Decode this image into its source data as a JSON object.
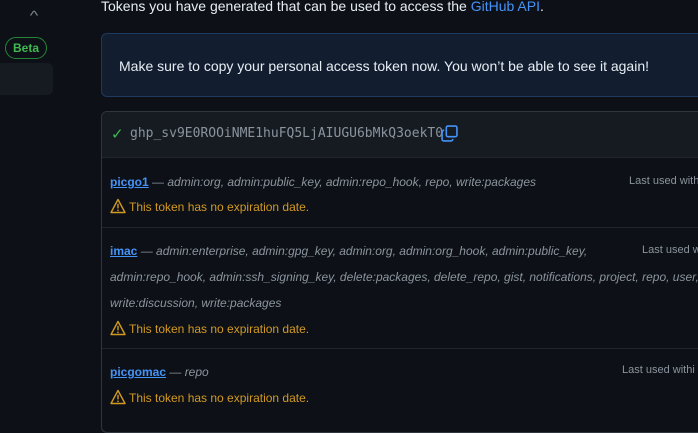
{
  "sidebar": {
    "chevron": "^",
    "beta_label": "Beta"
  },
  "intro": {
    "text": "Tokens you have generated that can be used to access the ",
    "link": "GitHub API",
    "end": "."
  },
  "flash": {
    "text": "Make sure to copy your personal access token now. You won’t be able to see it again!"
  },
  "new_token": {
    "value": "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"
  },
  "tokens": [
    {
      "name": "picgo1",
      "sep": " — ",
      "scope_lines": [
        "admin:org, admin:public_key, admin:repo_hook, repo, write:packages"
      ],
      "last_used": "Last used withi",
      "warning": "This token has no expiration date."
    },
    {
      "name": "imac",
      "sep": " — ",
      "scope_lines": [
        "admin:enterprise, admin:gpg_key, admin:org, admin:org_hook, admin:public_key,",
        "admin:repo_hook, admin:ssh_signing_key, delete:packages, delete_repo, gist, notifications, project, repo, user, workf",
        "write:discussion, write:packages"
      ],
      "last_used": "Last used wi",
      "warning": "This token has no expiration date."
    },
    {
      "name": "picgomac",
      "sep": " — ",
      "scope_lines": [
        "repo"
      ],
      "last_used": "Last used withi",
      "warning": "This token has no expiration date."
    }
  ],
  "colors": {
    "accent": "#4493f8",
    "success": "#3fb950",
    "warning": "#d29922"
  }
}
